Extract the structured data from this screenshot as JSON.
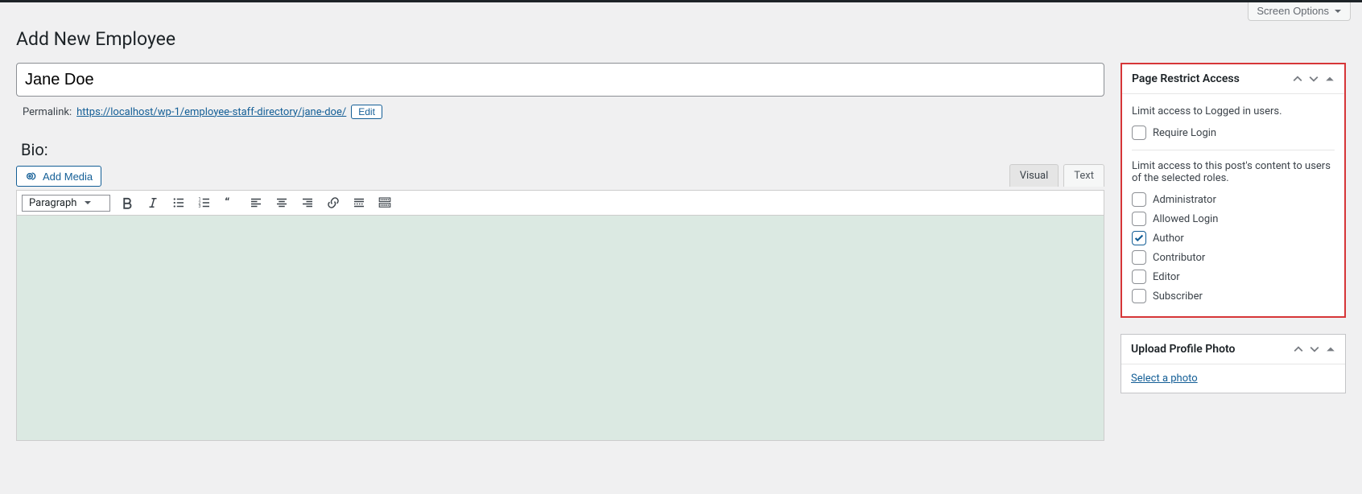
{
  "screen_options_label": "Screen Options",
  "page_title": "Add New Employee",
  "title_value": "Jane Doe",
  "permalink_label": "Permalink:",
  "permalink_base": "https://localhost/wp-1/employee-staff-directory/",
  "permalink_slug": "jane-doe/",
  "edit_label": "Edit",
  "bio_label": "Bio:",
  "add_media_label": "Add Media",
  "editor_tabs": {
    "visual": "Visual",
    "text": "Text"
  },
  "paragraph_select": "Paragraph",
  "restrict_panel": {
    "heading": "Page Restrict Access",
    "limit_login_text": "Limit access to Logged in users.",
    "require_login_label": "Require Login",
    "limit_roles_text": "Limit access to this post's content to users of the selected roles.",
    "roles": [
      {
        "label": "Administrator",
        "checked": false
      },
      {
        "label": "Allowed Login",
        "checked": false
      },
      {
        "label": "Author",
        "checked": true
      },
      {
        "label": "Contributor",
        "checked": false
      },
      {
        "label": "Editor",
        "checked": false
      },
      {
        "label": "Subscriber",
        "checked": false
      }
    ]
  },
  "upload_panel": {
    "heading": "Upload Profile Photo",
    "link": "Select a photo"
  }
}
